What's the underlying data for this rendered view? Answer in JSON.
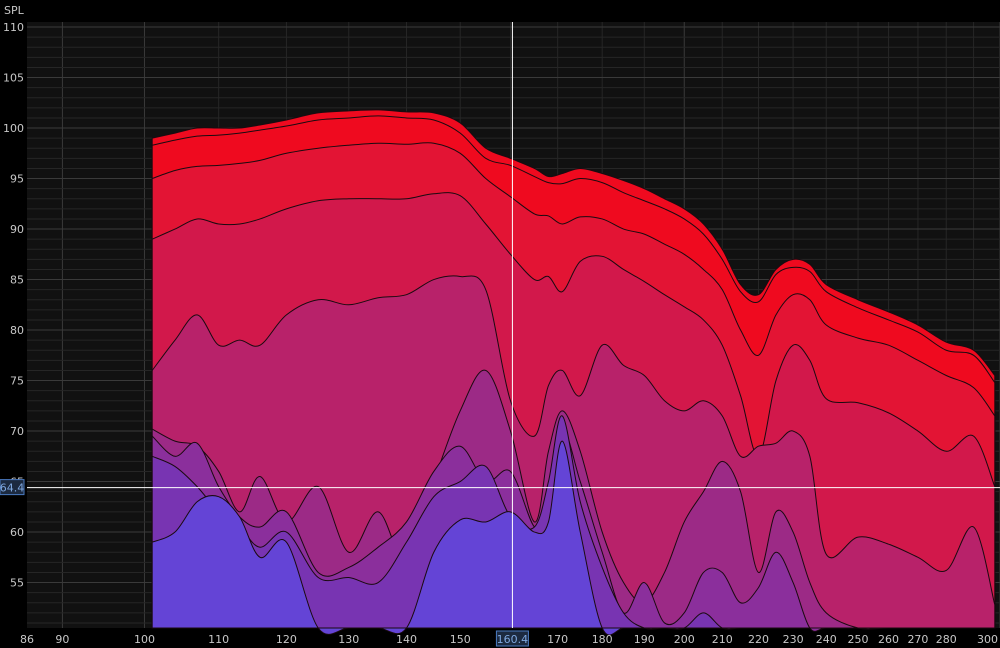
{
  "y_axis_title": "SPL",
  "cursor": {
    "x_value": "160.4",
    "y_value": "64.4",
    "x": 160.4,
    "y": 64.4
  },
  "colors": {
    "background": "#000000",
    "plot_bg": "#111111",
    "grid_major": "#3a3a3a",
    "grid_minor": "#262626",
    "cursor": "#ffffff",
    "cursor_label_bg": "#1c2a40",
    "cursor_label_text": "#7fa8e0",
    "cursor_label_border": "#4a7ac0"
  },
  "chart_data": {
    "type": "area",
    "title": "",
    "xlabel": "",
    "ylabel": "SPL",
    "x_scale": "log",
    "xlim": [
      86,
      300
    ],
    "ylim": [
      50.5,
      110.5
    ],
    "x_ticks": [
      "86",
      "90",
      "100",
      "110",
      "120",
      "130",
      "140",
      "150",
      "160.4",
      "170",
      "180",
      "190",
      "200",
      "210",
      "220",
      "230",
      "240",
      "250",
      "260",
      "270",
      "280",
      "300"
    ],
    "x_tick_values": [
      86,
      90,
      100,
      110,
      120,
      130,
      140,
      150,
      160.4,
      170,
      180,
      190,
      200,
      210,
      220,
      230,
      240,
      250,
      260,
      270,
      280,
      300
    ],
    "y_ticks": [
      55,
      60,
      65,
      70,
      75,
      80,
      85,
      90,
      95,
      100,
      105,
      110
    ],
    "x_major_grid": [
      90,
      100,
      200,
      300
    ],
    "x_minor_grid": [
      110,
      120,
      130,
      140,
      150,
      160,
      170,
      180,
      190,
      210,
      220,
      230,
      240,
      250,
      260,
      270,
      280,
      290
    ],
    "grid": true,
    "x": [
      101,
      104,
      107,
      110,
      113,
      116,
      120,
      125,
      130,
      135,
      140,
      145,
      150,
      155,
      160,
      165,
      168,
      171,
      175,
      180,
      185,
      190,
      195,
      200,
      205,
      210,
      215,
      220,
      225,
      230,
      235,
      240,
      250,
      260,
      270,
      280,
      290,
      298
    ],
    "series": [
      {
        "color": "#ef0a1f",
        "values": [
          99,
          99.5,
          100,
          100,
          100,
          100.3,
          100.8,
          101.5,
          101.7,
          101.8,
          101.6,
          101.5,
          100.5,
          98,
          97,
          96,
          95.2,
          95.5,
          96,
          95.5,
          94.8,
          94,
          93,
          92,
          90.5,
          88,
          84.5,
          83.5,
          86,
          87,
          86.5,
          84.5,
          83,
          81.8,
          80.5,
          78.8,
          78,
          75.5
        ]
      },
      {
        "color": "#ef0a1f",
        "values": [
          98.3,
          98.8,
          99.2,
          99.3,
          99.5,
          99.8,
          100.2,
          100.8,
          101,
          101.2,
          101,
          100.8,
          99.5,
          97,
          96.3,
          95.2,
          94.6,
          94.5,
          95,
          94.6,
          93.6,
          92.8,
          92,
          91,
          89.5,
          87,
          83.8,
          82.8,
          85.5,
          86.2,
          85.8,
          83.8,
          82.2,
          81,
          79.8,
          78,
          77.5,
          74.8
        ]
      },
      {
        "color": "#e31434",
        "values": [
          95,
          95.8,
          96.2,
          96.3,
          96.5,
          96.8,
          97.5,
          98,
          98.3,
          98.5,
          98.4,
          98.5,
          97.5,
          95,
          93.2,
          91.5,
          91.3,
          90.5,
          91.2,
          91,
          90,
          89.5,
          88.5,
          87.5,
          86,
          84,
          80,
          77.5,
          81.5,
          83.5,
          83,
          80.5,
          79.2,
          78.5,
          77,
          75.5,
          74.3,
          71.5
        ]
      },
      {
        "color": "#d2184b",
        "values": [
          89,
          90,
          91,
          90.5,
          90.5,
          91,
          92,
          92.8,
          93,
          93,
          93,
          93.5,
          93.3,
          90.5,
          87.5,
          85,
          85.3,
          83.8,
          86.8,
          87.3,
          86,
          84.8,
          83.5,
          82.3,
          81,
          78.5,
          73.5,
          67.5,
          75,
          78.5,
          77,
          73.2,
          72.8,
          71.8,
          70,
          68,
          69.5,
          64.5
        ]
      },
      {
        "color": "#b8226a",
        "values": [
          76,
          79,
          81.5,
          78.5,
          79,
          78.5,
          81.5,
          83,
          82.5,
          83.2,
          83.5,
          85,
          85.3,
          84,
          73,
          69.5,
          74.5,
          76,
          73.5,
          78.5,
          76.5,
          75.5,
          73,
          72,
          73,
          71.5,
          67.5,
          68.5,
          68.8,
          70,
          67.5,
          57.8,
          59.5,
          58.8,
          57.5,
          56.2,
          60.5,
          52.8
        ]
      },
      {
        "color": "#9c2a86",
        "values": [
          70.2,
          69,
          68.5,
          66,
          62,
          65.5,
          61,
          64.5,
          58,
          62,
          57,
          65,
          72,
          76,
          70,
          61,
          68,
          72,
          68,
          60,
          55,
          53,
          56,
          61,
          64,
          67,
          64,
          56,
          62,
          60,
          55,
          52,
          50.5,
          50.5,
          50.5,
          50.5,
          50.5,
          50.5
        ]
      },
      {
        "color": "#8b2f9c",
        "values": [
          69.5,
          67.5,
          68.8,
          64.5,
          61.5,
          60.5,
          62,
          56,
          56.5,
          58.5,
          61,
          66,
          68.5,
          65,
          66,
          60.5,
          62,
          70,
          65,
          58,
          52,
          55,
          51,
          52,
          56,
          56,
          53,
          54.5,
          58,
          55,
          50.5,
          50.5,
          50.5,
          50.5,
          50.5,
          50.5,
          50.5,
          50.5
        ]
      },
      {
        "color": "#7834b2",
        "values": [
          67.5,
          66.5,
          64.5,
          62,
          60.5,
          58.5,
          60,
          55.5,
          55.5,
          55,
          59,
          63.5,
          65,
          66.5,
          61.5,
          60.5,
          65,
          71.5,
          63,
          56.5,
          52,
          50.5,
          50.5,
          50.5,
          52,
          50.5,
          50.5,
          50.5,
          50.5,
          50.5,
          50.5,
          50.5,
          50.5,
          50.5,
          50.5,
          50.5,
          50.5,
          50.5
        ]
      },
      {
        "color": "#6444d6",
        "values": [
          59,
          60,
          63,
          63.5,
          61.5,
          57.5,
          59,
          50.5,
          50.5,
          50.5,
          50.5,
          58,
          61.2,
          61,
          62,
          60,
          61,
          69,
          60,
          50.5,
          50.5,
          50.5,
          50.5,
          50.5,
          50.5,
          50.5,
          50.5,
          50.5,
          50.5,
          50.5,
          50.5,
          50.5,
          50.5,
          50.5,
          50.5,
          50.5,
          50.5,
          50.5
        ]
      }
    ]
  }
}
